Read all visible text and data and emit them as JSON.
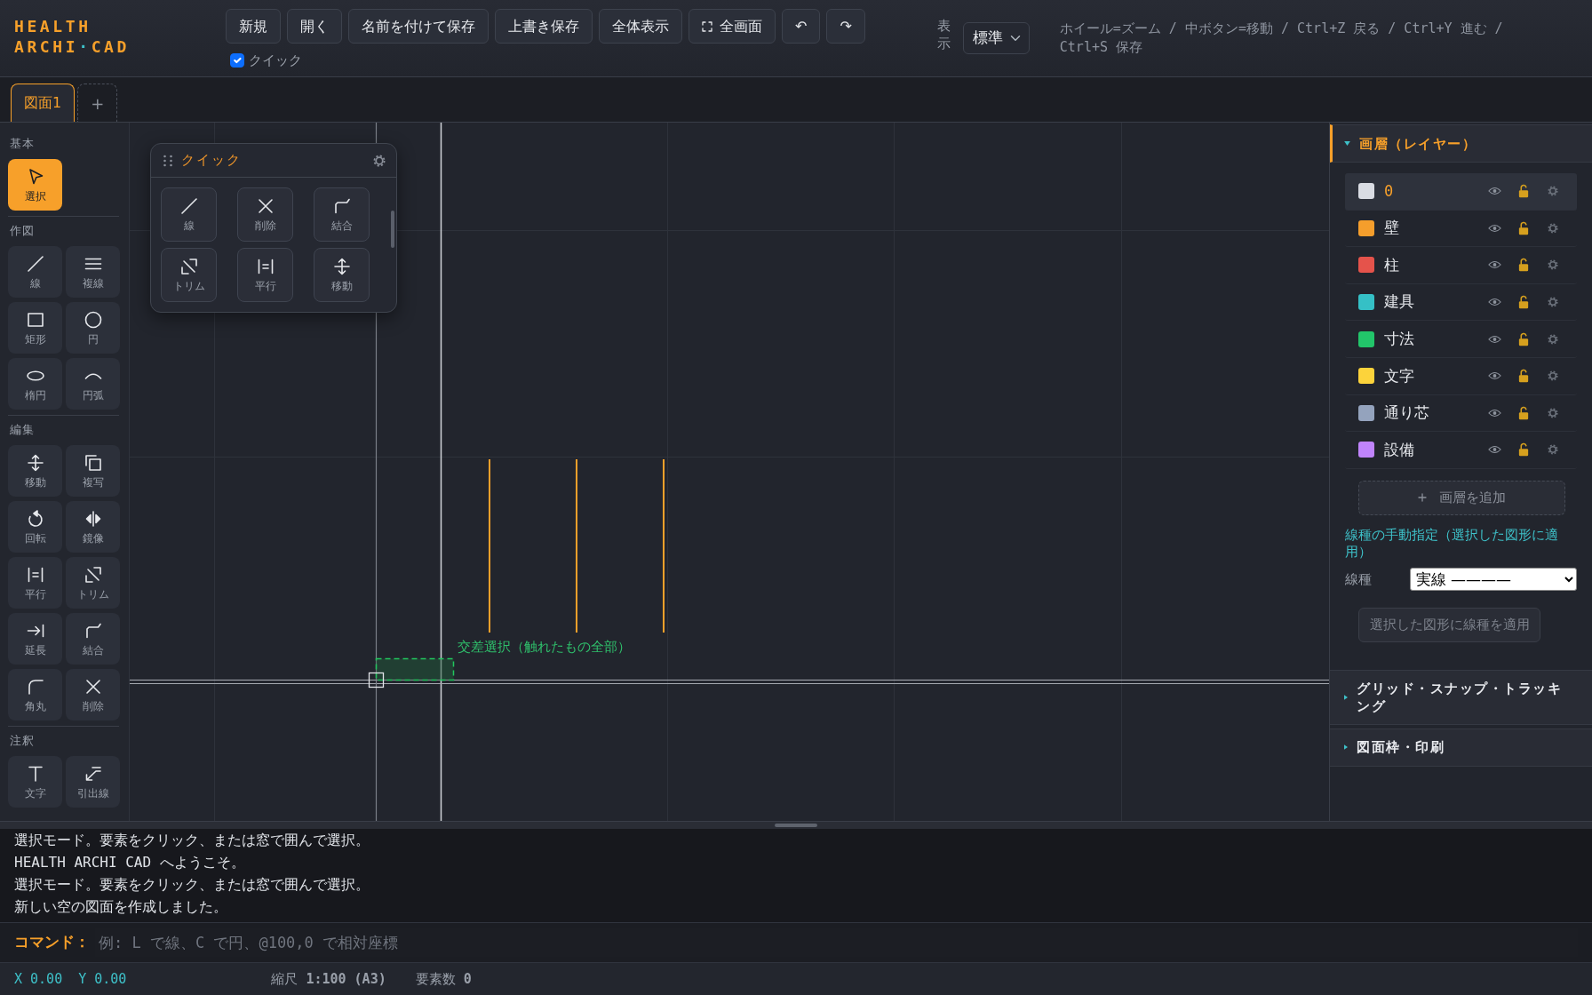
{
  "header": {
    "logo": [
      [
        {
          "text": "HEALTH",
          "accent": false
        }
      ],
      [
        {
          "text": "ARCHI",
          "accent": false
        },
        {
          "text": "·",
          "accent": true
        },
        {
          "text": "CAD",
          "accent": false
        }
      ]
    ],
    "buttons": [
      {
        "label": "新規",
        "kind": "plain"
      },
      {
        "label": "開く",
        "kind": "plain"
      },
      {
        "label": "名前を付けて保存",
        "kind": "plain"
      },
      {
        "label": "上書き保存",
        "kind": "plain"
      },
      {
        "label": "全体表示",
        "kind": "plain"
      },
      {
        "label": "全画面",
        "kind": "fullscreen"
      },
      {
        "label": "↶",
        "kind": "plain"
      },
      {
        "label": "↷",
        "kind": "plain"
      }
    ],
    "quick_toggle": {
      "label": "クイック",
      "checked": true
    },
    "view": {
      "label": "表示",
      "value": "標準"
    },
    "help": "ホイール=ズーム / 中ボタン=移動 / Ctrl+Z 戻る / Ctrl+Y 進む / Ctrl+S 保存"
  },
  "tabs": [
    {
      "label": "図面1",
      "selected": true
    }
  ],
  "add_tab": {
    "label": "+"
  },
  "toolbar": {
    "sections": [
      {
        "title": "基本",
        "tools": [
          {
            "label": "選択",
            "kind": "select",
            "selected": true
          }
        ]
      },
      {
        "title": "作図",
        "tools": [
          {
            "label": "線",
            "kind": "line",
            "selected": false
          },
          {
            "label": "複線",
            "kind": "multiline",
            "selected": false
          },
          {
            "label": "矩形",
            "kind": "rect",
            "selected": false
          },
          {
            "label": "円",
            "kind": "circle",
            "selected": false
          },
          {
            "label": "楕円",
            "kind": "ellipse",
            "selected": false
          },
          {
            "label": "円弧",
            "kind": "arc",
            "selected": false
          }
        ]
      },
      {
        "title": "編集",
        "tools": [
          {
            "label": "移動",
            "kind": "move",
            "selected": false
          },
          {
            "label": "複写",
            "kind": "copy",
            "selected": false
          },
          {
            "label": "回転",
            "kind": "rotate",
            "selected": false
          },
          {
            "label": "鏡像",
            "kind": "mirror",
            "selected": false
          },
          {
            "label": "平行",
            "kind": "parallel",
            "selected": false
          },
          {
            "label": "トリム",
            "kind": "trim",
            "selected": false
          },
          {
            "label": "延長",
            "kind": "extend",
            "selected": false
          },
          {
            "label": "結合",
            "kind": "join",
            "selected": false
          },
          {
            "label": "角丸",
            "kind": "fillet",
            "selected": false
          },
          {
            "label": "削除",
            "kind": "delete",
            "selected": false
          }
        ]
      },
      {
        "title": "注釈",
        "tools": [
          {
            "label": "文字",
            "kind": "text",
            "selected": false
          },
          {
            "label": "引出線",
            "kind": "leader",
            "selected": false
          }
        ]
      }
    ]
  },
  "quick_palette": {
    "title": "クイック",
    "tools": [
      {
        "label": "線",
        "kind": "line"
      },
      {
        "label": "削除",
        "kind": "delete"
      },
      {
        "label": "結合",
        "kind": "join"
      },
      {
        "label": "トリム",
        "kind": "trim"
      },
      {
        "label": "平行",
        "kind": "parallel"
      },
      {
        "label": "移動",
        "kind": "move"
      }
    ]
  },
  "canvas": {
    "hint": "交差選択（触れたもの全部）"
  },
  "right_panel": {
    "sections": [
      {
        "title": "画層（レイヤー）",
        "expanded": true,
        "layers": [
          {
            "name": "0",
            "color": "#d9dce3",
            "selected": true,
            "visible": true,
            "locked": false
          },
          {
            "name": "壁",
            "color": "#f59e2c",
            "selected": false,
            "visible": true,
            "locked": false
          },
          {
            "name": "柱",
            "color": "#e5534b",
            "selected": false,
            "visible": true,
            "locked": false
          },
          {
            "name": "建具",
            "color": "#35c0c6",
            "selected": false,
            "visible": true,
            "locked": false
          },
          {
            "name": "寸法",
            "color": "#22c56a",
            "selected": false,
            "visible": true,
            "locked": false
          },
          {
            "name": "文字",
            "color": "#fcd33b",
            "selected": false,
            "visible": true,
            "locked": false
          },
          {
            "name": "通り芯",
            "color": "#94a3bd",
            "selected": false,
            "visible": true,
            "locked": false
          },
          {
            "name": "設備",
            "color": "#c084fc",
            "selected": false,
            "visible": true,
            "locked": false
          }
        ],
        "add_button": "画層を追加",
        "linetype": {
          "heading": "線種の手動指定（選択した図形に適用）",
          "label": "線種",
          "value": "実線 ————",
          "apply": {
            "label": "選択した図形に線種を適用",
            "disabled": true
          }
        }
      },
      {
        "title": "グリッド・スナップ・トラッキング",
        "expanded": false
      },
      {
        "title": "図面枠・印刷",
        "expanded": false
      }
    ]
  },
  "log": [
    "選択モード。要素をクリック、または窓で囲んで選択。",
    "HEALTH ARCHI CAD へようこそ。",
    "選択モード。要素をクリック、または窓で囲んで選択。",
    "新しい空の図面を作成しました。"
  ],
  "command": {
    "label": "コマンド：",
    "placeholder": "例: L で線、C で円、@100,0 で相対座標"
  },
  "status": {
    "x": "X 0.00",
    "y": "Y 0.00",
    "scale": "縮尺 **1:100 (A3)**",
    "count": "要素数 **0**"
  }
}
